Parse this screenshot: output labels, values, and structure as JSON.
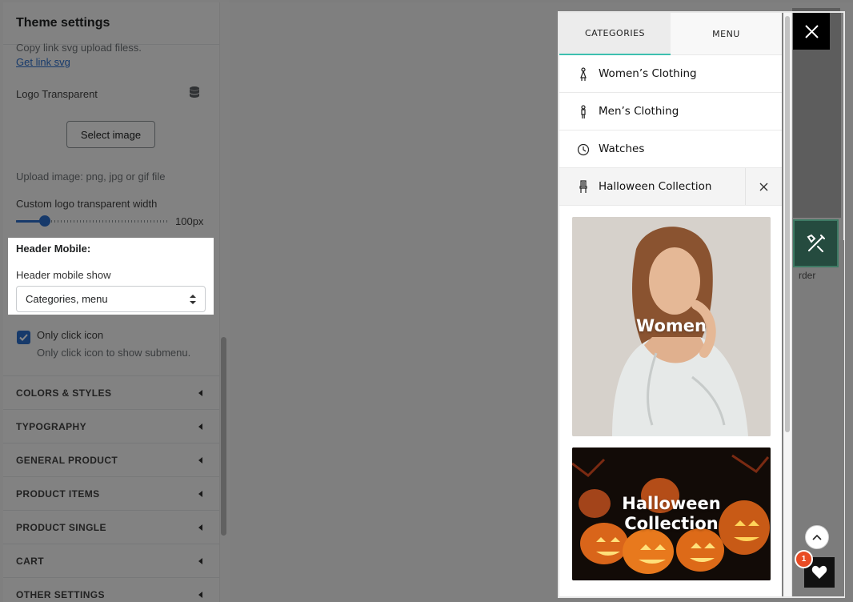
{
  "settings_panel": {
    "title": "Theme settings",
    "upload_hint_top": "Copy link svg upload filess.",
    "get_link_label": "Get link svg",
    "logo_transparent_label": "Logo Transparent",
    "select_image_label": "Select image",
    "upload_hint": "Upload image: png, jpg or gif file",
    "width_label": "Custom logo transparent width",
    "width_value": "100px",
    "width_fraction": 0.19,
    "header_mobile_heading": "Header Mobile:",
    "header_mobile_show_label": "Header mobile show",
    "header_mobile_show_value": "Categories, menu",
    "only_click_icon_label": "Only click icon",
    "only_click_icon_help": "Only click icon to show submenu.",
    "only_click_icon_checked": true,
    "sections": [
      "COLORS & STYLES",
      "TYPOGRAPHY",
      "GENERAL PRODUCT",
      "PRODUCT ITEMS",
      "PRODUCT SINGLE",
      "CART",
      "OTHER SETTINGS"
    ]
  },
  "drawer": {
    "tabs": [
      {
        "label": "CATEGORIES",
        "active": true
      },
      {
        "label": "MENU",
        "active": false
      }
    ],
    "items": [
      {
        "label": "Women’s Clothing",
        "icon": "woman-icon"
      },
      {
        "label": "Men’s Clothing",
        "icon": "man-icon"
      },
      {
        "label": "Watches",
        "icon": "clock-icon"
      },
      {
        "label": "Halloween Collection",
        "icon": "chair-icon",
        "active": true
      }
    ],
    "banners": [
      {
        "label": "Women"
      },
      {
        "label_line1": "Halloween",
        "label_line2": "Collection"
      }
    ]
  },
  "store_preview": {
    "order_text": "rder",
    "wishlist_count": "1"
  },
  "colors": {
    "accent": "#2c6ecb",
    "tab_underline": "#3ec0b0",
    "badge": "#e94b24"
  }
}
